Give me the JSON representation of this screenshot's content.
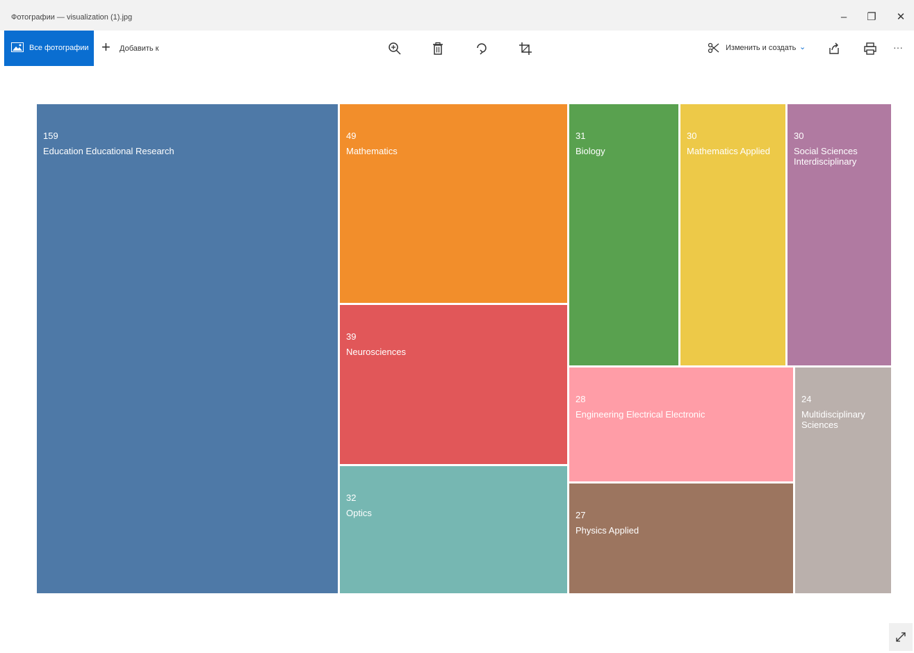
{
  "window": {
    "title": "Фотографии — visualization (1).jpg",
    "minimize_glyph": "–",
    "maximize_glyph": "❐",
    "close_glyph": "✕"
  },
  "toolbar": {
    "all_photos_label": "Все фотографии",
    "add_to_label": "Добавить к",
    "add_glyph": "+",
    "tools": [
      "zoom-icon",
      "delete-icon",
      "rotate-icon",
      "crop-icon"
    ],
    "edit_create_label": "Изменить и создать",
    "edit_create_chevron": "⌄",
    "right_tools": [
      "share-icon",
      "print-icon",
      "more-icon"
    ],
    "more_glyph": "···",
    "accent": "#0a6ed1"
  },
  "chart_data": {
    "type": "treemap",
    "items": [
      {
        "value": "159",
        "label": "Education Educational Research",
        "color": "#4e79a7"
      },
      {
        "value": "49",
        "label": "Mathematics",
        "color": "#f28e2b"
      },
      {
        "value": "39",
        "label": "Neurosciences",
        "color": "#e15759"
      },
      {
        "value": "32",
        "label": "Optics",
        "color": "#76b7b2"
      },
      {
        "value": "31",
        "label": "Biology",
        "color": "#59a14f"
      },
      {
        "value": "30",
        "label": "Mathematics Applied",
        "color": "#edc948"
      },
      {
        "value": "30",
        "label": "Social Sciences Interdisciplinary",
        "color": "#b07aa1"
      },
      {
        "value": "28",
        "label": "Engineering Electrical Electronic",
        "color": "#ff9da7"
      },
      {
        "value": "27",
        "label": "Physics Applied",
        "color": "#9c755f"
      },
      {
        "value": "24",
        "label": "Multidisciplinary Sciences",
        "color": "#bab0ac"
      }
    ]
  }
}
